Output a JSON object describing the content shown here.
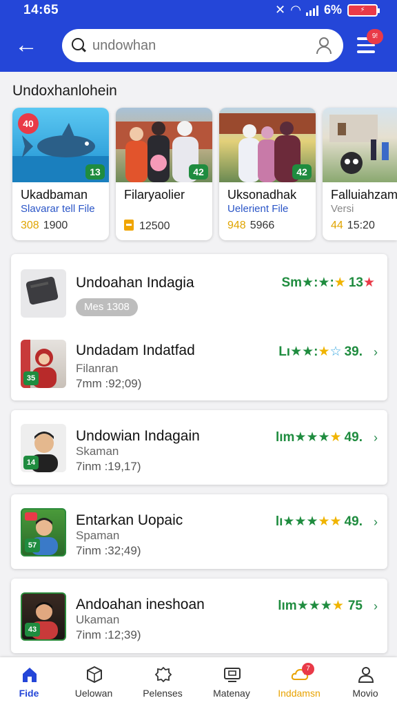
{
  "status": {
    "time": "14:65",
    "battery": "6%"
  },
  "search": {
    "placeholder": "undowhan"
  },
  "menu": {
    "badge": "9!"
  },
  "section": {
    "title": "Undoxhanlohein"
  },
  "cards": [
    {
      "corner": "40",
      "badge": "13",
      "title": "Ukadbaman",
      "sub": "Slavarar tell File",
      "acc": "308",
      "count": "1900",
      "thumb_color": "#2aa8e8"
    },
    {
      "badge": "42",
      "title": "Filaryaolier",
      "sub": "",
      "acc": "",
      "count": "12500",
      "thumb_color": "#6f8b6a"
    },
    {
      "badge": "42",
      "title": "Uksonadhak",
      "sub": "Uelerient File",
      "acc": "948",
      "count": "5966",
      "thumb_color": "#8a9a70"
    },
    {
      "title": "Falluiahzam",
      "sub": "Versi",
      "acc": "44",
      "count": "15:20",
      "thumb_color": "#9cb08a"
    }
  ],
  "list": [
    {
      "name": "Undoahan Indagia",
      "pill": "Mes 1308",
      "rating_prefix": "Sm",
      "rating_value": "13"
    },
    {
      "name": "Undadam Indatfad",
      "line2": "Filanran",
      "line3": "7mm :92;09)",
      "badge": "35",
      "rating_prefix": "Lı",
      "rating_value": "39."
    },
    {
      "name": "Undowian Indagain",
      "line2": "Skaman",
      "line3": "7inm :19,17)",
      "badge": "14",
      "rating_prefix": "lım",
      "rating_value": "49."
    },
    {
      "name": "Entarkan Uopaic",
      "line2": "Spaman",
      "line3": "7inm :32;49)",
      "badge": "57",
      "rating_prefix": "lı",
      "rating_value": "49."
    },
    {
      "name": "Andoahan ineshoan",
      "line2": "Ukaman",
      "line3": "7inm :12;39)",
      "badge": "43",
      "rating_prefix": "lım",
      "rating_value": "75"
    }
  ],
  "nav": [
    {
      "label": "Fide",
      "icon": "home-icon"
    },
    {
      "label": "Uelowan",
      "icon": "cube-icon"
    },
    {
      "label": "Pelenses",
      "icon": "cloud-gear-icon"
    },
    {
      "label": "Matenay",
      "icon": "tv-icon"
    },
    {
      "label": "Inddamsn",
      "icon": "cloud-icon",
      "badge": "7"
    },
    {
      "label": "Movio",
      "icon": "person-icon"
    }
  ]
}
